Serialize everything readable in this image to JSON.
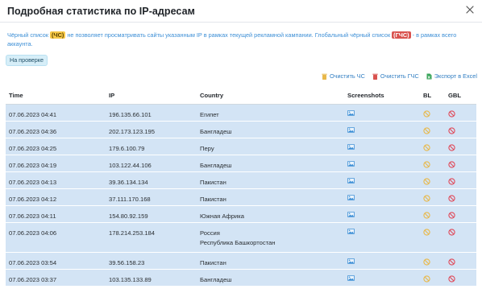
{
  "modal": {
    "title": "Подробная статистика по IP-адресам",
    "close_icon": "close-icon"
  },
  "notice": {
    "part1": "Чёрный список ",
    "tag1": "(ЧС)",
    "part2": " не позволяет просматривать сайты указанным IP в рамках текущей рекламной кампании. Глобальный чёрный список ",
    "tag2": "(ГЧС)",
    "part3": " - в рамках всего аккаунта."
  },
  "status_badge": "На проверке",
  "toolbar": {
    "clear_bl": "Очистить ЧС",
    "clear_gbl": "Очистить ГЧС",
    "export": "Экспорт в Excel"
  },
  "table": {
    "headers": {
      "time": "Time",
      "ip": "IP",
      "country": "Country",
      "screenshots": "Screenshots",
      "bl": "BL",
      "gbl": "GBL"
    },
    "rows": [
      {
        "time": "07.06.2023 04:41",
        "ip": "196.135.66.101",
        "country": "Египет",
        "region": ""
      },
      {
        "time": "07.06.2023 04:36",
        "ip": "202.173.123.195",
        "country": "Бангладеш",
        "region": ""
      },
      {
        "time": "07.06.2023 04:25",
        "ip": "179.6.100.79",
        "country": "Перу",
        "region": ""
      },
      {
        "time": "07.06.2023 04:19",
        "ip": "103.122.44.106",
        "country": "Бангладеш",
        "region": ""
      },
      {
        "time": "07.06.2023 04:13",
        "ip": "39.36.134.134",
        "country": "Пакистан",
        "region": ""
      },
      {
        "time": "07.06.2023 04:12",
        "ip": "37.111.170.168",
        "country": "Пакистан",
        "region": ""
      },
      {
        "time": "07.06.2023 04:11",
        "ip": "154.80.92.159",
        "country": "Южная Африка",
        "region": ""
      },
      {
        "time": "07.06.2023 04:06",
        "ip": "178.214.253.184",
        "country": "Россия",
        "region": "Республика Башкортостан"
      },
      {
        "time": "07.06.2023 03:54",
        "ip": "39.56.158.23",
        "country": "Пакистан",
        "region": ""
      },
      {
        "time": "07.06.2023 03:37",
        "ip": "103.135.133.89",
        "country": "Бангладеш",
        "region": ""
      }
    ]
  },
  "colors": {
    "row_bg": "#d3e4f5",
    "link": "#2f7dc2",
    "bl_icon": "#e8b84a",
    "gbl_icon": "#e04a5a"
  }
}
